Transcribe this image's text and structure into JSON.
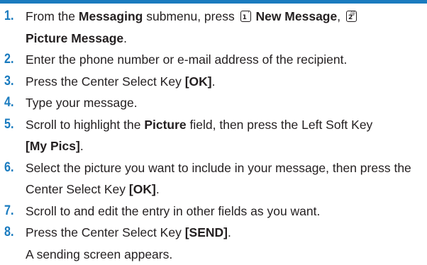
{
  "colors": {
    "accent": "#1a7bbf",
    "text": "#231f20"
  },
  "steps": [
    {
      "number": "1.",
      "t1": "From the ",
      "b1": "Messaging",
      "t2": " submenu, press ",
      "key1_main": "1",
      "key1_sup": "'",
      "b2": "New Message",
      "t3": ", ",
      "key2_main": "2",
      "key2_sup": "@",
      "b3": "Picture Message",
      "t4": "."
    },
    {
      "number": "2.",
      "t1": "Enter the phone number or e-mail address of the recipient."
    },
    {
      "number": "3.",
      "t1": "Press the Center Select Key ",
      "b1": "[OK]",
      "t2": "."
    },
    {
      "number": "4.",
      "t1": "Type your message."
    },
    {
      "number": "5.",
      "t1": "Scroll to highlight the ",
      "b1": "Picture",
      "t2": " field, then press the Left Soft Key ",
      "b2": "[My Pics]",
      "t3": "."
    },
    {
      "number": "6.",
      "t1": "Select the picture you want to include in your message, then press the Center Select Key ",
      "b1": "[OK]",
      "t2": "."
    },
    {
      "number": "7.",
      "t1": "Scroll to and edit the entry in other fields as you want."
    },
    {
      "number": "8.",
      "t1": "Press the Center Select Key ",
      "b1": "[SEND]",
      "t2": "."
    }
  ],
  "after_note": "A sending screen appears."
}
